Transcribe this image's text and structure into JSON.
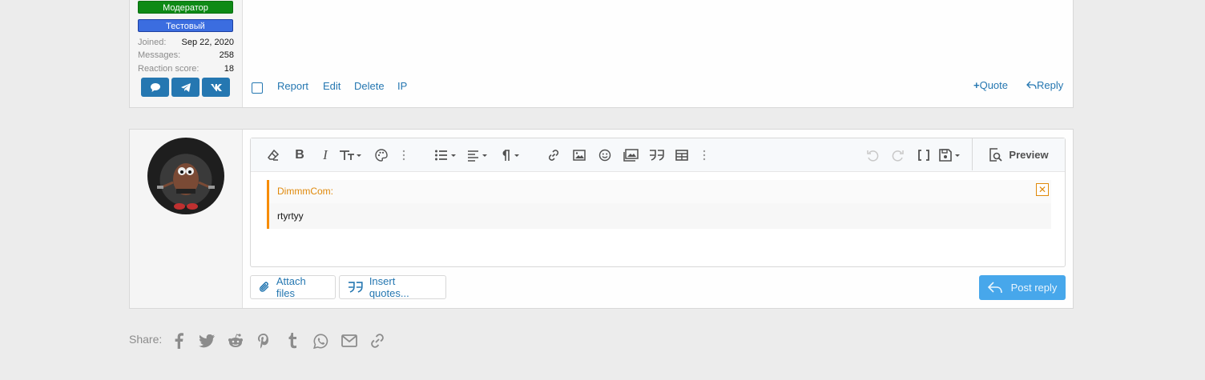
{
  "author": {
    "banners": [
      {
        "label": "Модератор",
        "color": "#0e8a16"
      },
      {
        "label": "Тестовый",
        "color": "#3b6de0"
      }
    ],
    "stats": [
      {
        "key": "Joined:",
        "value": "Sep 22, 2020"
      },
      {
        "key": "Messages:",
        "value": "258"
      },
      {
        "key": "Reaction score:",
        "value": "18"
      }
    ],
    "social_icons": [
      "chat-icon",
      "telegram-icon",
      "vk-icon"
    ]
  },
  "post_actions": {
    "report": "Report",
    "edit": "Edit",
    "delete": "Delete",
    "ip": "IP",
    "quote": "Quote",
    "reply": "Reply"
  },
  "editor": {
    "toolbar_icons": [
      "eraser-icon",
      "bold-icon",
      "italic-icon",
      "font-size-icon",
      "palette-icon",
      "more-icon",
      "list-icon",
      "align-icon",
      "paragraph-icon",
      "link-icon",
      "image-icon",
      "smilie-icon",
      "media-icon",
      "quote-icon",
      "table-icon",
      "more-icon",
      "undo-icon",
      "redo-icon",
      "bbcode-icon",
      "drafts-icon"
    ],
    "preview_label": "Preview",
    "quote": {
      "author": "DimmmCom:",
      "text": "rtyrtyy"
    }
  },
  "buttons": {
    "attach_files": "Attach files",
    "insert_quotes": "Insert quotes...",
    "post_reply": "Post reply"
  },
  "share": {
    "label": "Share:",
    "icons": [
      "facebook-icon",
      "twitter-icon",
      "reddit-icon",
      "pinterest-icon",
      "tumblr-icon",
      "whatsapp-icon",
      "email-icon",
      "link-icon"
    ]
  },
  "colors": {
    "link": "#2577b1",
    "quote_accent": "#f78c00",
    "post_reply_bg": "#47a7eb"
  }
}
